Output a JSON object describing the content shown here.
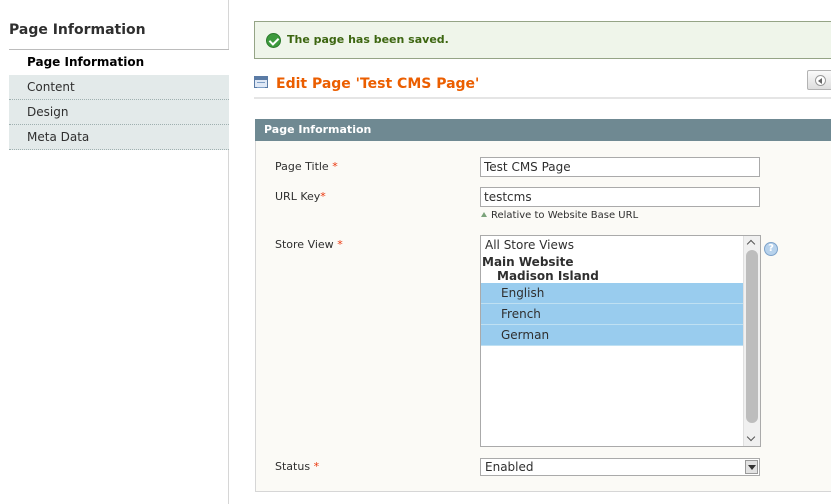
{
  "sidebar": {
    "title": "Page Information",
    "tabs": [
      {
        "label": "Page Information",
        "active": true
      },
      {
        "label": "Content",
        "active": false
      },
      {
        "label": "Design",
        "active": false
      },
      {
        "label": "Meta Data",
        "active": false
      }
    ]
  },
  "message": {
    "text": "The page has been saved.",
    "icon": "success-check-icon"
  },
  "header": {
    "title": "Edit Page 'Test CMS Page'",
    "icon": "cms-page-icon",
    "back_icon": "back-arrow-icon"
  },
  "fieldset": {
    "title": "Page Information",
    "required_mark": "*",
    "fields": {
      "page_title": {
        "label": "Page Title",
        "value": "Test CMS Page"
      },
      "url_key": {
        "label": "URL Key",
        "value": "testcms",
        "note": "Relative to Website Base URL"
      },
      "store_view": {
        "label": "Store View",
        "options": {
          "all": "All Store Views",
          "website": "Main Website",
          "store": "Madison Island",
          "views": [
            "English",
            "French",
            "German"
          ]
        },
        "selected": [
          "English",
          "French",
          "German"
        ],
        "help": "?"
      },
      "status": {
        "label": "Status",
        "value": "Enabled"
      }
    }
  },
  "colors": {
    "accent": "#eb5e00",
    "fieldset_header": "#6f8992",
    "selected_option": "#99ccee",
    "success_text": "#3d6611"
  }
}
